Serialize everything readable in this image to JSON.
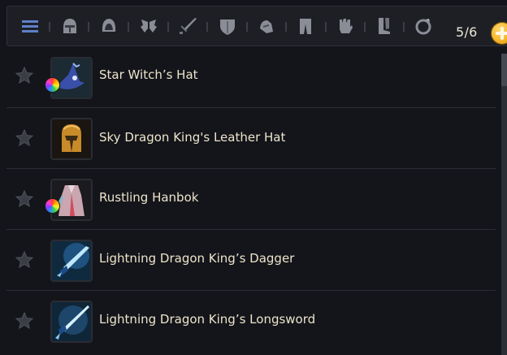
{
  "toolbar": {
    "filters": [
      {
        "icon": "list-menu-icon"
      },
      {
        "icon": "helmet-icon"
      },
      {
        "icon": "hood-icon"
      },
      {
        "icon": "wings-icon"
      },
      {
        "icon": "sword-icon"
      },
      {
        "icon": "shield-icon"
      },
      {
        "icon": "shoulder-armor-icon"
      },
      {
        "icon": "leg-armor-icon"
      },
      {
        "icon": "gloves-icon"
      },
      {
        "icon": "boots-icon"
      },
      {
        "icon": "ring-icon"
      }
    ],
    "count": "5/6"
  },
  "items": [
    {
      "name": "Star Witch’s Hat",
      "icon": "witch-hat-icon",
      "rainbow": true
    },
    {
      "name": "Sky Dragon King's Leather Hat",
      "icon": "leather-helmet-icon",
      "rainbow": false
    },
    {
      "name": "Rustling Hanbok",
      "icon": "hanbok-icon",
      "rainbow": true
    },
    {
      "name": "Lightning Dragon King’s Dagger",
      "icon": "dagger-icon",
      "rainbow": false
    },
    {
      "name": "Lightning Dragon King’s Longsword",
      "icon": "longsword-icon",
      "rainbow": false
    }
  ],
  "colors": {
    "accent": "#f5b529",
    "background": "#14151a",
    "text": "#ece4cc"
  }
}
